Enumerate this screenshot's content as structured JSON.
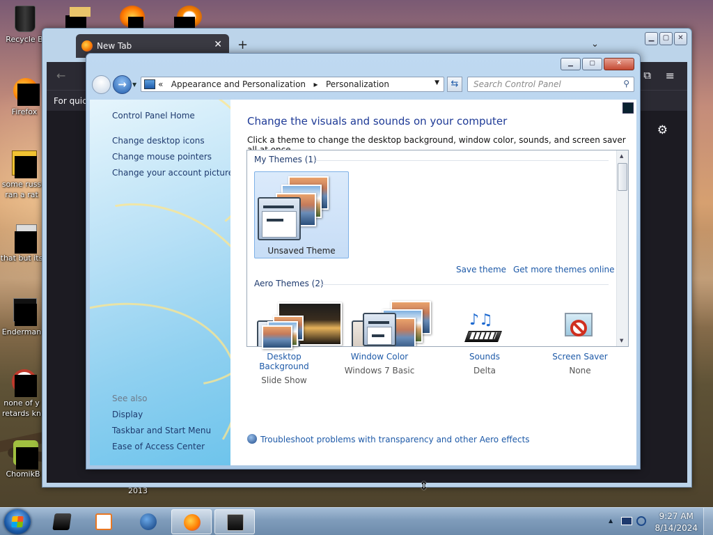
{
  "desktop": {
    "icons": [
      {
        "label": "Recycle B"
      },
      {
        "label": "Firefox"
      },
      {
        "label": "some russ ran a rat"
      },
      {
        "label": "that but its"
      },
      {
        "label": "Enderman"
      },
      {
        "label": "none of y retards kn"
      },
      {
        "label": "ChomikB"
      }
    ],
    "stray_text": "2013"
  },
  "firefox": {
    "tab_title": "New Tab",
    "tab_close": "✕",
    "new_tab": "+",
    "list_tabs": "⌄",
    "bookmarks_text": "For quick",
    "back": "←",
    "menu": "≡",
    "extensions": "⧉",
    "settings": "⚙"
  },
  "control_panel": {
    "breadcrumb": {
      "prefix": "«",
      "items": [
        "Appearance and Personalization",
        "Personalization"
      ],
      "separator": "▸"
    },
    "search_placeholder": "Search Control Panel",
    "left_nav": {
      "home": "Control Panel Home",
      "links": [
        "Change desktop icons",
        "Change mouse pointers",
        "Change your account picture"
      ],
      "see_also_title": "See also",
      "see_also": [
        "Display",
        "Taskbar and Start Menu",
        "Ease of Access Center"
      ]
    },
    "title": "Change the visuals and sounds on your computer",
    "description": "Click a theme to change the desktop background, window color, sounds, and screen saver all at once.",
    "my_themes_header": "My Themes (1)",
    "selected_theme": "Unsaved Theme",
    "save_theme": "Save theme",
    "more_themes": "Get more themes online",
    "aero_header": "Aero Themes (2)",
    "bottom_items": [
      {
        "title": "Desktop Background",
        "value": "Slide Show",
        "icon": "desktop-background-icon"
      },
      {
        "title": "Window Color",
        "value": "Windows 7 Basic",
        "icon": "window-color-icon"
      },
      {
        "title": "Sounds",
        "value": "Delta",
        "icon": "sounds-icon"
      },
      {
        "title": "Screen Saver",
        "value": "None",
        "icon": "screen-saver-icon"
      }
    ],
    "troubleshoot": "Troubleshoot problems with transparency and other Aero effects"
  },
  "taskbar": {
    "time": "9:27 AM",
    "date": "8/14/2024",
    "tray_up": "▲"
  },
  "colors": {
    "link": "#1e5aa8",
    "heading": "#1e3a96",
    "selection": "#c7ddf6"
  }
}
